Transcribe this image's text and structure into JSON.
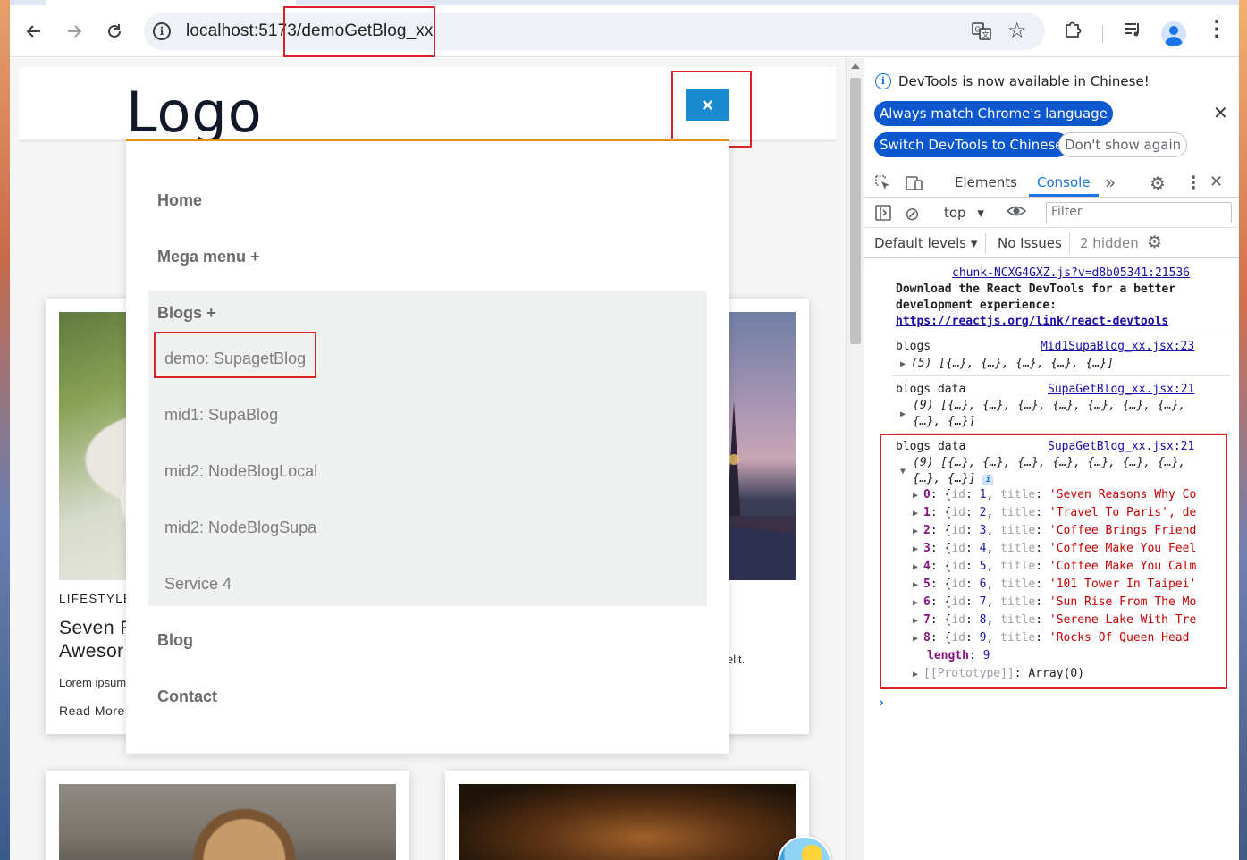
{
  "browser": {
    "url": "localhost:5173/demoGetBlog_xx"
  },
  "page": {
    "logo": "Logo",
    "close_label": "×",
    "menu": {
      "home": "Home",
      "mega": "Mega menu +",
      "blogs": "Blogs +",
      "submenu": [
        "demo: SupagetBlog",
        "mid1: SupaBlog",
        "mid2: NodeBlogLocal",
        "mid2: NodeBlogSupa",
        "Service 4"
      ],
      "blog": "Blog",
      "contact": "Contact"
    },
    "card1": {
      "category": "LIFESTYLE",
      "title_line1": "Seven F",
      "title_line2": "Awesor",
      "excerpt": "Lorem ipsum",
      "read_more": "Read More"
    },
    "card2": {
      "excerpt_tail": "elit."
    }
  },
  "devtools": {
    "banner": "DevTools is now available in Chinese!",
    "btn_match": "Always match Chrome's language",
    "btn_switch": "Switch DevTools to Chinese",
    "btn_dont": "Don't show again",
    "tabs": {
      "elements": "Elements",
      "console": "Console"
    },
    "context": "top",
    "filter_placeholder": "Filter",
    "levels": "Default levels",
    "issues": "No Issues",
    "hidden": "2 hidden",
    "console": {
      "msg1_link": "chunk-NCXG4GXZ.js?v=d8b05341:21536",
      "msg1_line1": "Download the React DevTools for a better",
      "msg1_line2": "development experience:",
      "msg1_url": "https://reactjs.org/link/react-devtools",
      "msg2_label": "blogs",
      "msg2_link": "Mid1SupaBlog_xx.jsx:23",
      "msg2_value": "(5) [{…}, {…}, {…}, {…}, {…}]",
      "msg3_label": "blogs data",
      "msg3_link": "SupaGetBlog_xx.jsx:21",
      "msg3_value1": "(9) [{…}, {…}, {…}, {…}, {…}, {…}, {…},",
      "msg3_value2": "{…}, {…}]",
      "msg4_label": "blogs data",
      "msg4_link": "SupaGetBlog_xx.jsx:21",
      "msg4_value1": "(9) [{…}, {…}, {…}, {…}, {…}, {…}, {…},",
      "msg4_value2": "{…}, {…}]",
      "entries": [
        {
          "idx": "0",
          "id": "1",
          "title": "'Seven Reasons Why Co"
        },
        {
          "idx": "1",
          "id": "2",
          "title": "'Travel To Paris', de"
        },
        {
          "idx": "2",
          "id": "3",
          "title": "'Coffee Brings Friend"
        },
        {
          "idx": "3",
          "id": "4",
          "title": "'Coffee Make You Feel"
        },
        {
          "idx": "4",
          "id": "5",
          "title": "'Coffee Make You Calm"
        },
        {
          "idx": "5",
          "id": "6",
          "title": "'101 Tower In Taipei'"
        },
        {
          "idx": "6",
          "id": "7",
          "title": "'Sun Rise From The Mo"
        },
        {
          "idx": "7",
          "id": "8",
          "title": "'Serene Lake With Tre"
        },
        {
          "idx": "8",
          "id": "9",
          "title": "'Rocks Of Queen Head"
        }
      ],
      "length_label": "length",
      "length_value": "9",
      "prototype": "[[Prototype]]",
      "prototype_value": "Array(0)"
    }
  },
  "colors": {
    "highlight": "#d8232a",
    "menu_accent": "#e8900e",
    "close_button": "#1a8bd0",
    "devtools_primary": "#0b57d0"
  }
}
